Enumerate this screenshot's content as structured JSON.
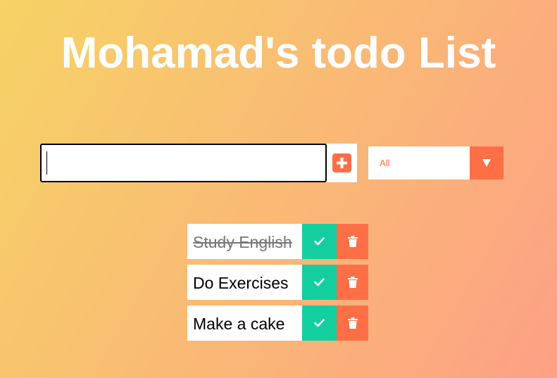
{
  "header": {
    "title": "Mohamad's todo List"
  },
  "form": {
    "input_value": "",
    "add_icon": "plus-square-icon",
    "filter": {
      "selected": "All",
      "arrow_icon": "caret-down-icon"
    }
  },
  "todos": [
    {
      "text": "Study English",
      "completed": true
    },
    {
      "text": "Do Exercises",
      "completed": false
    },
    {
      "text": "Make a cake",
      "completed": false
    }
  ],
  "icons": {
    "complete": "check-icon",
    "delete": "trash-icon"
  },
  "colors": {
    "gradient_start": "#f6d365",
    "gradient_end": "#fda085",
    "accent": "#ff6f47",
    "complete": "#13cfa0"
  }
}
